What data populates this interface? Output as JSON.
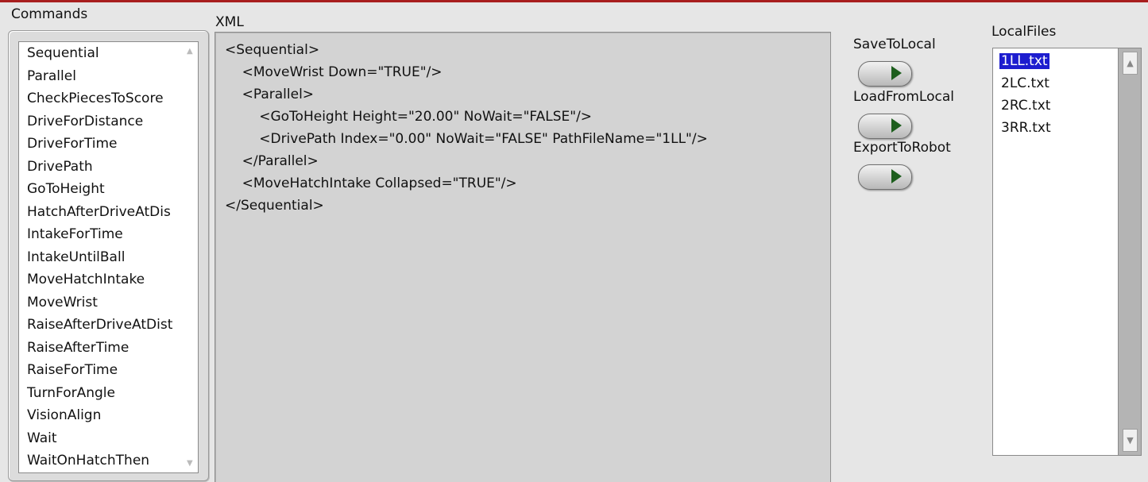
{
  "commands": {
    "label": "Commands",
    "items": [
      "Sequential",
      "Parallel",
      "CheckPiecesToScore",
      "DriveForDistance",
      "DriveForTime",
      "DrivePath",
      "GoToHeight",
      "HatchAfterDriveAtDis",
      "IntakeForTime",
      "IntakeUntilBall",
      "MoveHatchIntake",
      "MoveWrist",
      "RaiseAfterDriveAtDist",
      "RaiseAfterTime",
      "RaiseForTime",
      "TurnForAngle",
      "VisionAlign",
      "Wait",
      "WaitOnHatchThen"
    ]
  },
  "xml": {
    "label": "XML",
    "lines": [
      "<Sequential>",
      "    <MoveWrist Down=\"TRUE\"/>",
      "    <Parallel>",
      "        <GoToHeight Height=\"20.00\" NoWait=\"FALSE\"/>",
      "        <DrivePath Index=\"0.00\" NoWait=\"FALSE\" PathFileName=\"1LL\"/>",
      "    </Parallel>",
      "    <MoveHatchIntake Collapsed=\"TRUE\"/>",
      "</Sequential>"
    ]
  },
  "buttons": {
    "save_label": "SaveToLocal",
    "load_label": "LoadFromLocal",
    "export_label": "ExportToRobot"
  },
  "local_files": {
    "label": "LocalFiles",
    "items": [
      "1LL.txt",
      "2LC.txt",
      "2RC.txt",
      "3RR.txt"
    ],
    "selected": "1LL.txt"
  },
  "colors": {
    "accent_bar": "#a81e1e",
    "selection": "#1d1dcf",
    "led_green": "#1d5e1d"
  }
}
